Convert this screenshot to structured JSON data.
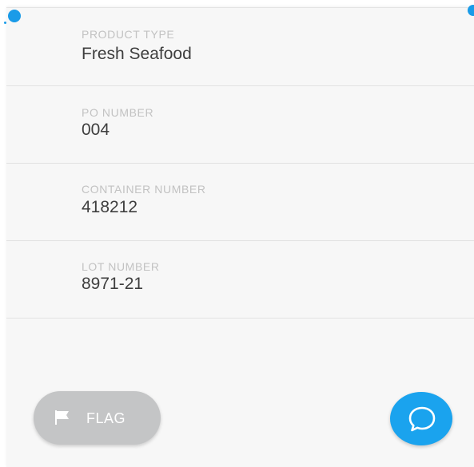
{
  "fields": [
    {
      "label": "PRODUCT TYPE",
      "value": "Fresh Seafood"
    },
    {
      "label": "PO NUMBER",
      "value": "004"
    },
    {
      "label": "CONTAINER NUMBER",
      "value": "418212"
    },
    {
      "label": "LOT NUMBER",
      "value": "8971-21"
    }
  ],
  "actions": {
    "flag_label": "FLAG",
    "flag_icon": "flag-icon",
    "chat_icon": "chat-bubble-icon"
  },
  "colors": {
    "accent": "#1aa3ee",
    "flag_button_bg": "#c4c5c6",
    "panel_bg": "#f7f7f7",
    "label_text": "#c2c2c2",
    "value_text": "#3e3e3e"
  }
}
